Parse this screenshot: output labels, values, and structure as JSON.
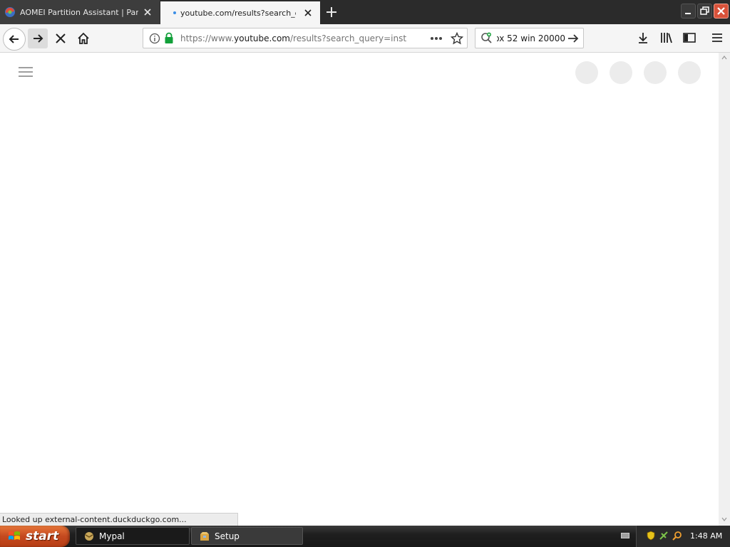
{
  "tabs": [
    {
      "title": "AOMEI Partition Assistant | Partition"
    },
    {
      "title": "youtube.com/results?search_query"
    }
  ],
  "urlbar": {
    "prefix": "https://www.",
    "host": "youtube.com",
    "rest": "/results?search_query=instr"
  },
  "searchbar": {
    "value": "ox 52 win 20000"
  },
  "statusbar": {
    "text": "Looked up external-content.duckduckgo.com..."
  },
  "taskbar": {
    "start_label": "start",
    "items": [
      {
        "label": "Mypal"
      },
      {
        "label": "Setup"
      }
    ],
    "clock": "1:48 AM"
  },
  "colors": {
    "accent": "#3a8ee6",
    "close": "#d9523a",
    "start": "#c4491f"
  }
}
